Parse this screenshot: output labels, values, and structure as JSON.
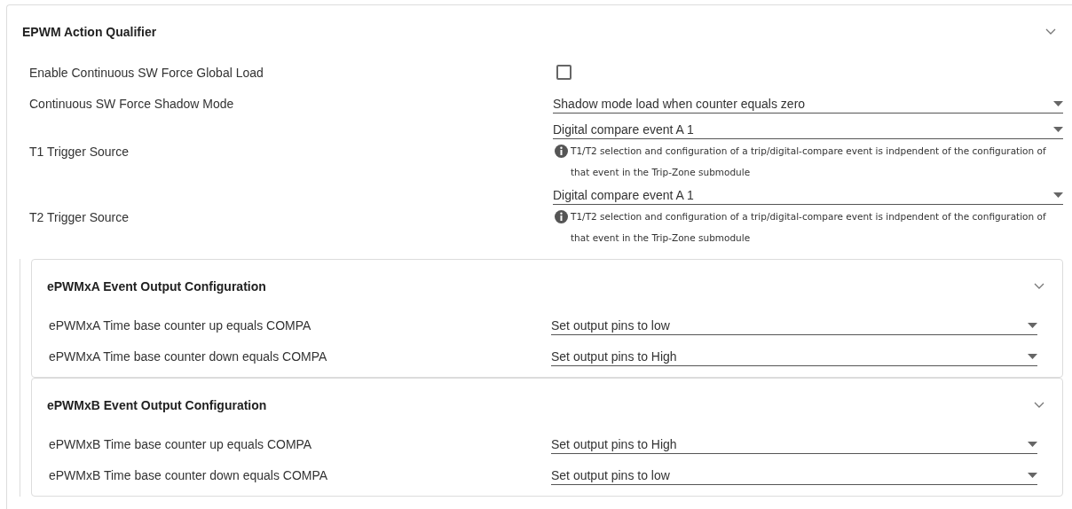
{
  "section": {
    "title": "EPWM Action Qualifier",
    "expanded": true,
    "fields": [
      {
        "kind": "checkbox",
        "label": "Enable Continuous SW Force Global Load",
        "checked": false
      },
      {
        "kind": "select",
        "label": "Continuous SW Force Shadow Mode",
        "value": "Shadow mode load when counter equals zero"
      },
      {
        "kind": "select",
        "label": "T1 Trigger Source",
        "value": "Digital compare event A 1",
        "note": "T1/T2 selection and configuration of a trip/digital-compare event is indpendent of the configuration of that event in the Trip-Zone submodule"
      },
      {
        "kind": "select",
        "label": "T2 Trigger Source",
        "value": "Digital compare event A 1",
        "note": "T1/T2 selection and configuration of a trip/digital-compare event is indpendent of the configuration of that event in the Trip-Zone submodule"
      }
    ],
    "subsections": [
      {
        "title": "ePWMxA Event Output Configuration",
        "expanded": true,
        "fields": [
          {
            "kind": "select",
            "label": "ePWMxA Time base counter up equals COMPA",
            "value": "Set output pins to low"
          },
          {
            "kind": "select",
            "label": "ePWMxA Time base counter down equals COMPA",
            "value": "Set output pins to High"
          }
        ]
      },
      {
        "title": "ePWMxB Event Output Configuration",
        "expanded": true,
        "fields": [
          {
            "kind": "select",
            "label": "ePWMxB Time base counter up equals COMPA",
            "value": "Set output pins to High"
          },
          {
            "kind": "select",
            "label": "ePWMxB Time base counter down equals COMPA",
            "value": "Set output pins to low"
          }
        ]
      }
    ]
  }
}
